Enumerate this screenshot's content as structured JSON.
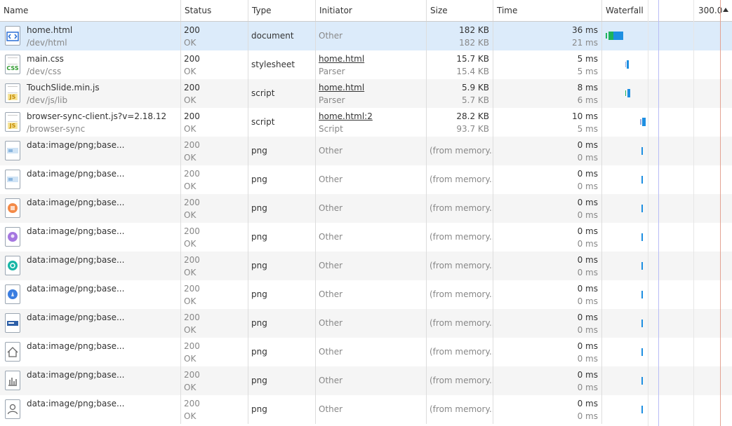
{
  "columns": {
    "name": "Name",
    "status": "Status",
    "type": "Type",
    "initiator": "Initiator",
    "size": "Size",
    "time": "Time",
    "waterfall": "Waterfall",
    "waterfall_scale": "300.0"
  },
  "colors": {
    "selected_row": "#dcebfa",
    "alt_row": "#f5f5f5",
    "bar_waiting": "#1fb35b",
    "bar_receiving": "#1e8fe1",
    "dom_content_line": "#9aa0f0",
    "load_line": "#d9765f"
  },
  "rows": [
    {
      "icon": "html-file-icon",
      "name": "home.html",
      "path": "/dev/html",
      "status": "200",
      "status_text": "OK",
      "type": "document",
      "initiator": "Other",
      "initiator_link": false,
      "initiator_sub": "",
      "size": "182 KB",
      "size2": "182 KB",
      "time": "36 ms",
      "time2": "21 ms",
      "selected": true
    },
    {
      "icon": "css-file-icon",
      "name": "main.css",
      "path": "/dev/css",
      "status": "200",
      "status_text": "OK",
      "type": "stylesheet",
      "initiator": "home.html",
      "initiator_link": true,
      "initiator_sub": "Parser",
      "size": "15.7 KB",
      "size2": "15.4 KB",
      "time": "5 ms",
      "time2": "5 ms",
      "selected": false
    },
    {
      "icon": "js-file-icon",
      "name": "TouchSlide.min.js",
      "path": "/dev/js/lib",
      "status": "200",
      "status_text": "OK",
      "type": "script",
      "initiator": "home.html",
      "initiator_link": true,
      "initiator_sub": "Parser",
      "size": "5.9 KB",
      "size2": "5.7 KB",
      "time": "8 ms",
      "time2": "6 ms",
      "selected": false
    },
    {
      "icon": "js-file-icon",
      "name": "browser-sync-client.js?v=2.18.12",
      "path": "/browser-sync",
      "status": "200",
      "status_text": "OK",
      "type": "script",
      "initiator": "home.html:2",
      "initiator_link": true,
      "initiator_sub": "Script",
      "size": "28.2 KB",
      "size2": "93.7 KB",
      "time": "10 ms",
      "time2": "5 ms",
      "selected": false
    },
    {
      "icon": "image-thumbnail-icon",
      "name": "data:image/png;base...",
      "path": "",
      "status": "200",
      "status_text": "OK",
      "type": "png",
      "initiator": "Other",
      "initiator_link": false,
      "initiator_sub": "",
      "size": "(from memory...",
      "size2": "",
      "time": "0 ms",
      "time2": "0 ms",
      "selected": false
    },
    {
      "icon": "image-thumbnail-icon",
      "name": "data:image/png;base...",
      "path": "",
      "status": "200",
      "status_text": "OK",
      "type": "png",
      "initiator": "Other",
      "initiator_link": false,
      "initiator_sub": "",
      "size": "(from memory...",
      "size2": "",
      "time": "0 ms",
      "time2": "0 ms",
      "selected": false
    },
    {
      "icon": "orange-circle-icon",
      "name": "data:image/png;base...",
      "path": "",
      "status": "200",
      "status_text": "OK",
      "type": "png",
      "initiator": "Other",
      "initiator_link": false,
      "initiator_sub": "",
      "size": "(from memory...",
      "size2": "",
      "time": "0 ms",
      "time2": "0 ms",
      "selected": false
    },
    {
      "icon": "purple-circle-icon",
      "name": "data:image/png;base...",
      "path": "",
      "status": "200",
      "status_text": "OK",
      "type": "png",
      "initiator": "Other",
      "initiator_link": false,
      "initiator_sub": "",
      "size": "(from memory...",
      "size2": "",
      "time": "0 ms",
      "time2": "0 ms",
      "selected": false
    },
    {
      "icon": "teal-circle-icon",
      "name": "data:image/png;base...",
      "path": "",
      "status": "200",
      "status_text": "OK",
      "type": "png",
      "initiator": "Other",
      "initiator_link": false,
      "initiator_sub": "",
      "size": "(from memory...",
      "size2": "",
      "time": "0 ms",
      "time2": "0 ms",
      "selected": false
    },
    {
      "icon": "blue-circle-icon",
      "name": "data:image/png;base...",
      "path": "",
      "status": "200",
      "status_text": "OK",
      "type": "png",
      "initiator": "Other",
      "initiator_link": false,
      "initiator_sub": "",
      "size": "(from memory...",
      "size2": "",
      "time": "0 ms",
      "time2": "0 ms",
      "selected": false
    },
    {
      "icon": "banner-image-icon",
      "name": "data:image/png;base...",
      "path": "",
      "status": "200",
      "status_text": "OK",
      "type": "png",
      "initiator": "Other",
      "initiator_link": false,
      "initiator_sub": "",
      "size": "(from memory...",
      "size2": "",
      "time": "0 ms",
      "time2": "0 ms",
      "selected": false
    },
    {
      "icon": "home-icon",
      "name": "data:image/png;base...",
      "path": "",
      "status": "200",
      "status_text": "OK",
      "type": "png",
      "initiator": "Other",
      "initiator_link": false,
      "initiator_sub": "",
      "size": "(from memory...",
      "size2": "",
      "time": "0 ms",
      "time2": "0 ms",
      "selected": false
    },
    {
      "icon": "bar-chart-icon",
      "name": "data:image/png;base...",
      "path": "",
      "status": "200",
      "status_text": "OK",
      "type": "png",
      "initiator": "Other",
      "initiator_link": false,
      "initiator_sub": "",
      "size": "(from memory...",
      "size2": "",
      "time": "0 ms",
      "time2": "0 ms",
      "selected": false
    },
    {
      "icon": "user-icon",
      "name": "data:image/png;base...",
      "path": "",
      "status": "200",
      "status_text": "OK",
      "type": "png",
      "initiator": "Other",
      "initiator_link": false,
      "initiator_sub": "",
      "size": "(from memory...",
      "size2": "",
      "time": "0 ms",
      "time2": "0 ms",
      "selected": false
    }
  ]
}
